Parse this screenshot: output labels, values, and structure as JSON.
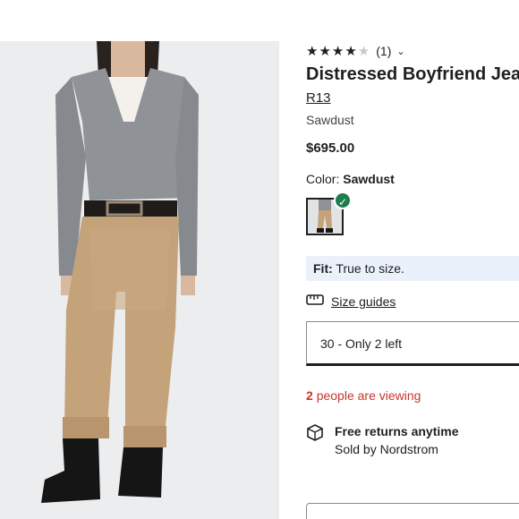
{
  "product": {
    "rating_count": "(1)",
    "rating_stars": 4,
    "rating_max": 5,
    "title": "Distressed Boyfriend Jeans",
    "brand": "R13",
    "color_name": "Sawdust",
    "price": "$695.00"
  },
  "color_picker": {
    "label": "Color:",
    "selected": "Sawdust"
  },
  "fit": {
    "label": "Fit:",
    "text": "True to size."
  },
  "size_guide": {
    "label": "Size guides"
  },
  "size_select": {
    "value": "30 - Only 2 left"
  },
  "viewing": {
    "count": "2",
    "text": "people are viewing"
  },
  "returns": {
    "title": "Free returns anytime",
    "subtitle": "Sold by Nordstrom"
  },
  "colors": {
    "accent_green": "#1e7d4f",
    "viewing_red": "#c7362b",
    "fit_bg": "#eaf1fb"
  }
}
